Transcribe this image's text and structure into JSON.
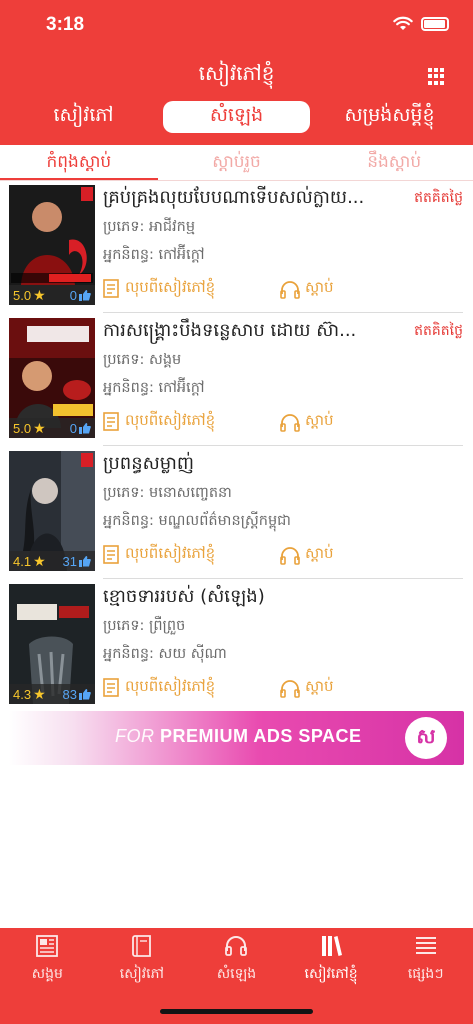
{
  "status_bar": {
    "time": "3:18"
  },
  "header": {
    "title": "សៀវភៅខ្ញុំ",
    "segments": [
      {
        "label": "សៀវភៅ",
        "active": false
      },
      {
        "label": "សំឡេង",
        "active": true
      },
      {
        "label": "សម្រង់សម្ដីខ្ញុំ",
        "active": false
      }
    ]
  },
  "subtabs": [
    {
      "label": "កំពុងស្ដាប់",
      "active": true
    },
    {
      "label": "ស្ដាប់រួច",
      "active": false
    },
    {
      "label": "នឹងស្ដាប់",
      "active": false
    }
  ],
  "colors": {
    "brand_red": "#ee3e3a",
    "action_orange": "#e9a23b",
    "rating_star": "#f7c62c",
    "likes_blue": "#56a5f4"
  },
  "items": [
    {
      "title": "គ្រប់គ្រងលុយបែបណាទើបសល់ក្លាយ...",
      "badge": "ឥតគិតថ្លៃ",
      "category": "ប្រភេទ: អាជីវកម្ម",
      "author": "អ្នកនិពន្ធ: កៅអ៊ីក្ដៅ",
      "rating": "5.0",
      "likes": "0",
      "remove_label": "លុបពីសៀវភៅខ្ញុំ",
      "listen_label": "ស្ដាប់"
    },
    {
      "title": "ការសង្គ្រោះបឹងទន្លេសាប ដោយ ស៊ា...",
      "badge": "ឥតគិតថ្លៃ",
      "category": "ប្រភេទ: សង្គម",
      "author": "អ្នកនិពន្ធ: កៅអ៊ីក្ដៅ",
      "rating": "5.0",
      "likes": "0",
      "remove_label": "លុបពីសៀវភៅខ្ញុំ",
      "listen_label": "ស្ដាប់"
    },
    {
      "title": "ប្រពន្ធសម្លាញ់",
      "badge": "",
      "category": "ប្រភេទ: មនោសញ្ចេតនា",
      "author": "អ្នកនិពន្ធ: មណ្ឌលព័ត៌មានស្ត្រីកម្ពុជា",
      "rating": "4.1",
      "likes": "31",
      "remove_label": "លុបពីសៀវភៅខ្ញុំ",
      "listen_label": "ស្ដាប់"
    },
    {
      "title": "ខ្មោចទាររបស់ (សំឡេង)",
      "badge": "",
      "category": "ប្រភេទ: ព្រឺព្រួច",
      "author": "អ្នកនិពន្ធ: សយ ស៊ីណា",
      "rating": "4.3",
      "likes": "83",
      "remove_label": "លុបពីសៀវភៅខ្ញុំ",
      "listen_label": "ស្ដាប់"
    }
  ],
  "ad": {
    "prefix": "FOR",
    "text": "PREMIUM ADS SPACE",
    "logo": "ស"
  },
  "tabbar": [
    {
      "label": "សង្គម",
      "icon": "newspaper-icon",
      "active": false
    },
    {
      "label": "សៀវភៅ",
      "icon": "book-icon",
      "active": false
    },
    {
      "label": "សំឡេង",
      "icon": "headphones-icon",
      "active": false
    },
    {
      "label": "សៀវភៅខ្ញុំ",
      "icon": "bookshelf-icon",
      "active": true
    },
    {
      "label": "ផ្សេងៗ",
      "icon": "menu-lines-icon",
      "active": false
    }
  ]
}
